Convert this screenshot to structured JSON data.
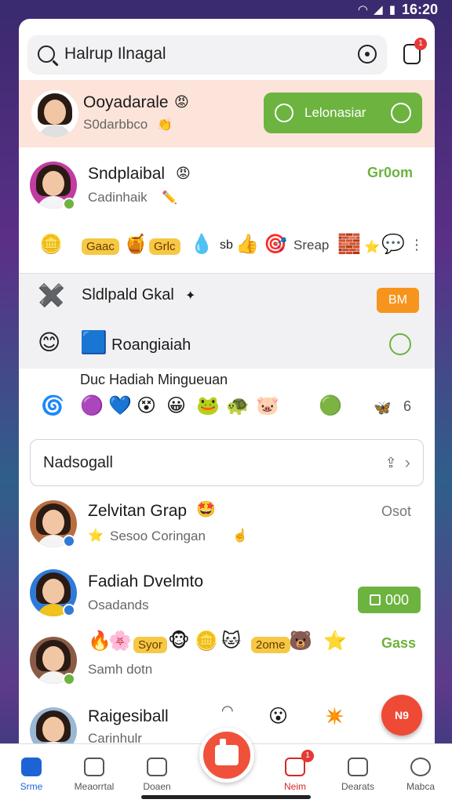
{
  "status_bar": {
    "time": "16:20"
  },
  "search": {
    "value": "Halrup Ilnagal"
  },
  "top_notification_count": "1",
  "featured": {
    "name": "Ooyadarale",
    "sub": "S0darbbco",
    "button_label": "Lelonasiar"
  },
  "contact_1": {
    "name": "Sndplaibal",
    "sub": "Cadinhaik",
    "time": "Gr0om"
  },
  "emoji_row_1": {
    "labels": [
      "Gaac",
      "Grlc",
      "sb",
      "Sreap"
    ]
  },
  "group_row": {
    "name": "Sldlpald Gkal",
    "badge": "BM"
  },
  "ranging_row": {
    "name": "Roangiaiah"
  },
  "sticker_section": {
    "title": "Duc Hadiah Mingueuan",
    "count": "6"
  },
  "nadsogall": {
    "label": "Nadsogall"
  },
  "chat_1": {
    "name": "Zelvitan Grap",
    "sub": "Sesoo Coringan",
    "time": "Osot"
  },
  "chat_2": {
    "name": "Fadiah Dvelmto",
    "sub": "Osadands",
    "button_label": "000"
  },
  "chat_3_emoji": {
    "labels": [
      "Syor",
      "2ome"
    ],
    "time": "Gass"
  },
  "chat_3": {
    "sub": "Samh dotn"
  },
  "chat_4": {
    "name": "Raigesiball",
    "sub": "Carinhulr"
  },
  "fab_right_label": "N9",
  "tabs": [
    {
      "label": "Srme"
    },
    {
      "label": "Meaorrtal"
    },
    {
      "label": "Doaen"
    },
    {
      "label": "Neim",
      "count": "1"
    },
    {
      "label": "Dearats"
    },
    {
      "label": "Mabca"
    }
  ]
}
